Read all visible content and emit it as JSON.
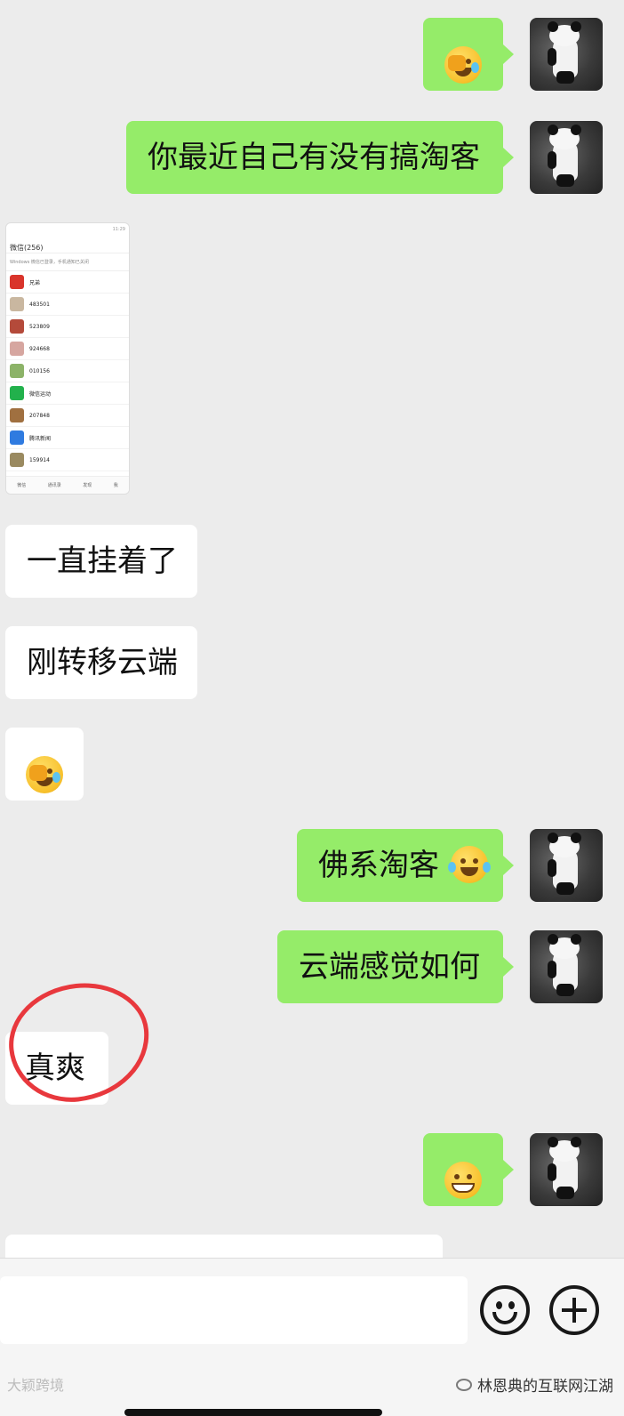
{
  "messages": [
    {
      "id": "m1",
      "side": "right",
      "emoji": "facepalm-emoji"
    },
    {
      "id": "m2",
      "side": "right",
      "text": "你最近自己有没有搞淘客"
    },
    {
      "id": "m3",
      "side": "left",
      "image": "wechat-screenshot"
    },
    {
      "id": "m4",
      "side": "left",
      "text": "一直挂着了"
    },
    {
      "id": "m5",
      "side": "left",
      "text": "刚转移云端"
    },
    {
      "id": "m6",
      "side": "left",
      "emoji": "facepalm-emoji"
    },
    {
      "id": "m7",
      "side": "right",
      "text": "佛系淘客",
      "emoji": "tears-of-joy-emoji"
    },
    {
      "id": "m8",
      "side": "right",
      "text": "云端感觉如何"
    },
    {
      "id": "m9",
      "side": "left",
      "text": "真爽",
      "annotation": "red hand-drawn circle"
    },
    {
      "id": "m10",
      "side": "right",
      "emoji": "grin-emoji"
    }
  ],
  "thumbnail": {
    "title": "微信(256)",
    "status": "11:29",
    "notice": "Windows 微信已登录，手机通知已关闭",
    "rows": [
      {
        "name": "兄弟",
        "color": "#d9342b"
      },
      {
        "name": "483501",
        "color": "#c9b7a0"
      },
      {
        "name": "523809",
        "color": "#b44a3a"
      },
      {
        "name": "924668",
        "color": "#d6a6a0"
      },
      {
        "name": "010156",
        "color": "#8cb368"
      },
      {
        "name": "微信运动",
        "color": "#22b14c"
      },
      {
        "name": "207848",
        "color": "#a07040"
      },
      {
        "name": "腾讯新闻",
        "color": "#2f7be0"
      },
      {
        "name": "159914",
        "color": "#9a8a60"
      }
    ],
    "tabs": [
      "微信",
      "通讯录",
      "发现",
      "我"
    ]
  },
  "watermark_left": "大颖跨境",
  "watermark_right": "林恩典的互联网江湖",
  "colors": {
    "sent_bubble": "#95ec69",
    "received_bubble": "#ffffff",
    "annotation": "#e8383d",
    "background": "#ececec"
  }
}
